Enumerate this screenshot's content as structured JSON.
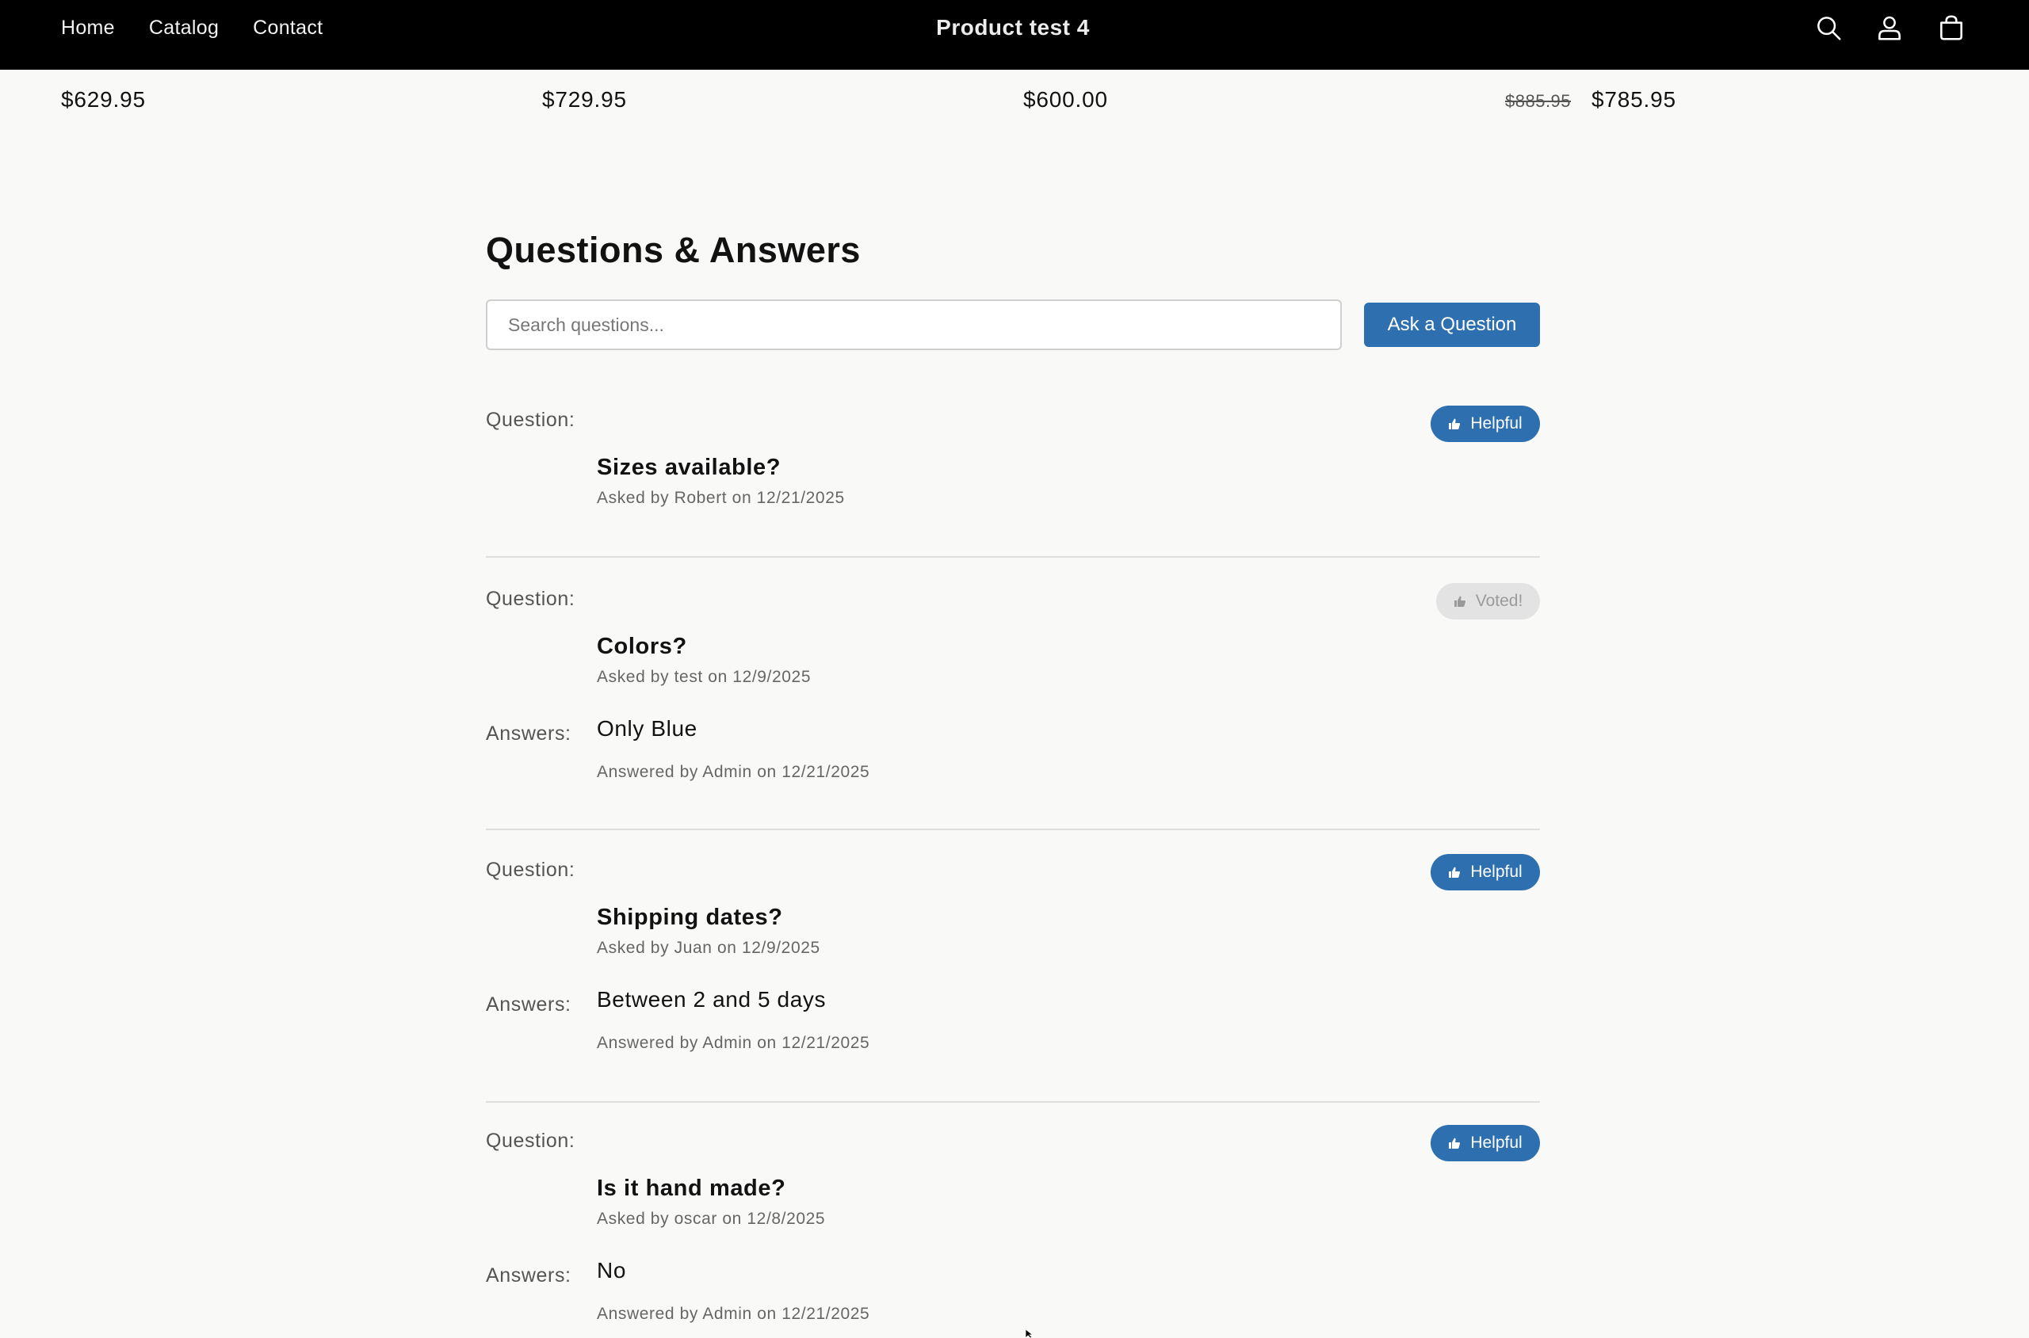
{
  "header": {
    "nav": [
      "Home",
      "Catalog",
      "Contact"
    ],
    "title": "Product test 4",
    "icons": [
      "search-icon",
      "account-icon",
      "cart-icon"
    ]
  },
  "products": [
    {
      "price": "$629.95"
    },
    {
      "price": "$729.95"
    },
    {
      "price": "$600.00"
    },
    {
      "compare_price": "$885.95",
      "price": "$785.95"
    }
  ],
  "qa": {
    "title": "Questions & Answers",
    "search_placeholder": "Search questions...",
    "ask_label": "Ask a Question",
    "question_label": "Question:",
    "answers_label": "Answers:",
    "items": [
      {
        "question": "Sizes available?",
        "asked": "Asked by Robert on 12/21/2025",
        "vote_label": "Helpful",
        "voted": false
      },
      {
        "question": "Colors?",
        "asked": "Asked by test on 12/9/2025",
        "answer": "Only Blue",
        "answered": "Answered by Admin on 12/21/2025",
        "vote_label": "Voted!",
        "voted": true
      },
      {
        "question": "Shipping dates?",
        "asked": "Asked by Juan on 12/9/2025",
        "answer": "Between 2 and 5 days",
        "answered": "Answered by Admin on 12/21/2025",
        "vote_label": "Helpful",
        "voted": false
      },
      {
        "question": "Is it hand made?",
        "asked": "Asked by oscar on 12/8/2025",
        "answer": "No",
        "answered": "Answered by Admin on 12/21/2025",
        "vote_label": "Helpful",
        "voted": false
      }
    ]
  },
  "colors": {
    "accent": "#2e6fb0",
    "header_bg": "#000000",
    "page_bg": "#f9f9f8",
    "voted_bg": "#e3e3e3"
  }
}
